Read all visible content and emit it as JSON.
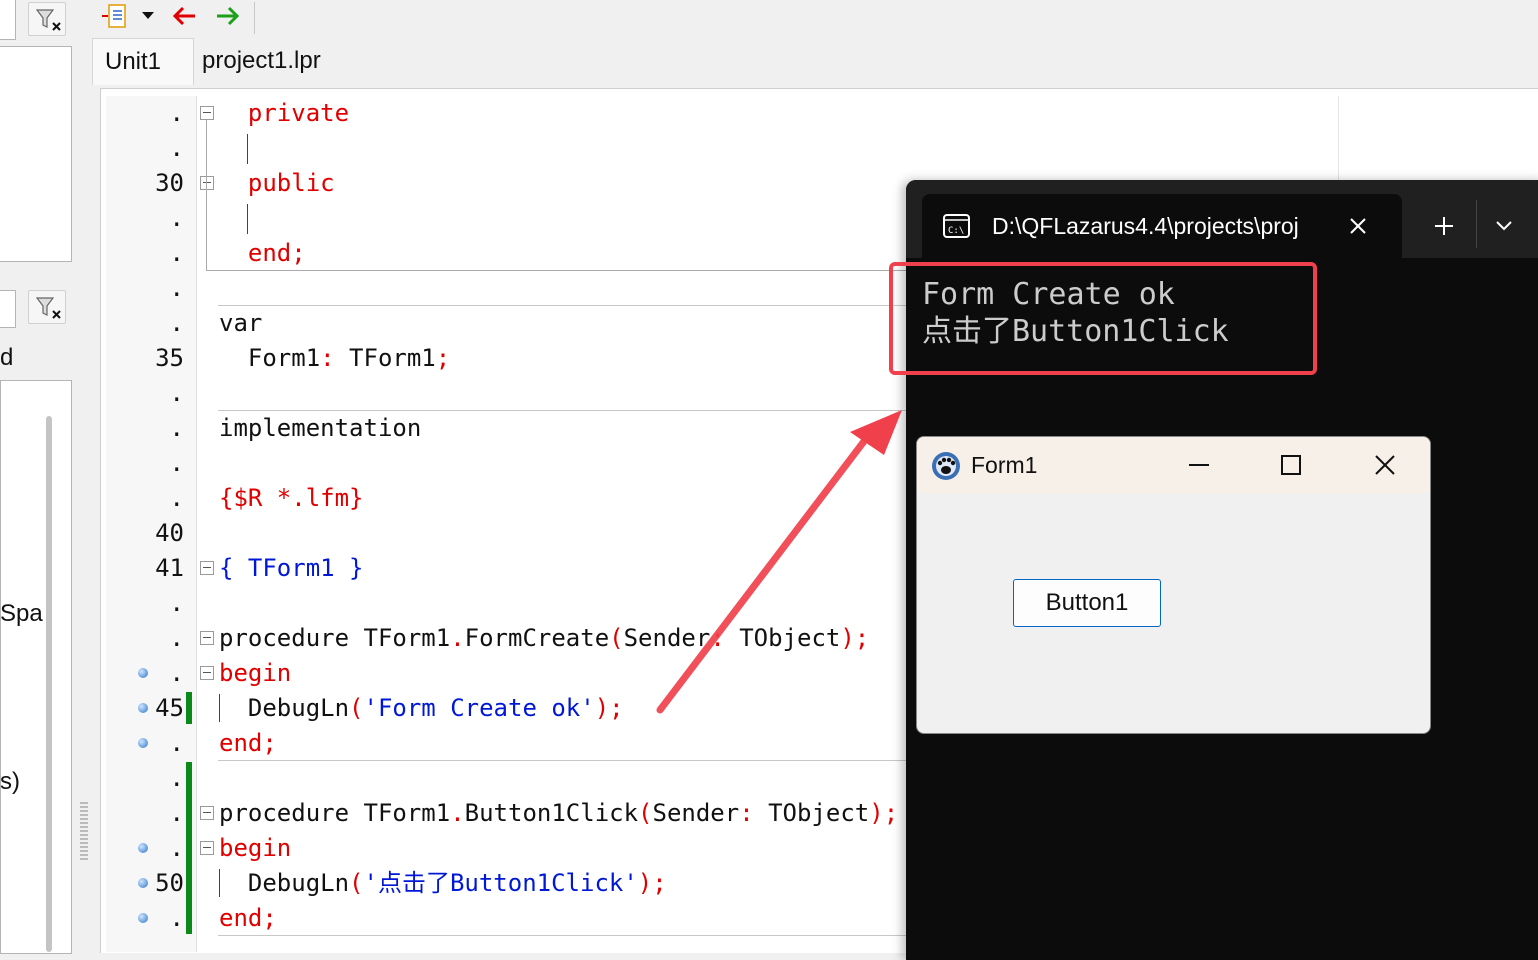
{
  "tabs": [
    {
      "label": "Unit1",
      "active": true
    },
    {
      "label": "project1.lpr",
      "active": false
    }
  ],
  "left_panel": {
    "fragments": [
      "d",
      "Spa",
      "s)"
    ]
  },
  "code": {
    "lines": [
      {
        "num": ".",
        "tokens": [
          {
            "t": "  "
          },
          {
            "t": "private",
            "c": "kw"
          }
        ]
      },
      {
        "num": ".",
        "tokens": []
      },
      {
        "num": "30",
        "tokens": [
          {
            "t": "  "
          },
          {
            "t": "public",
            "c": "kw"
          }
        ]
      },
      {
        "num": ".",
        "tokens": []
      },
      {
        "num": ".",
        "tokens": [
          {
            "t": "  "
          },
          {
            "t": "end",
            "c": "kw"
          },
          {
            "t": ";",
            "c": "sym"
          }
        ]
      },
      {
        "num": ".",
        "tokens": []
      },
      {
        "num": ".",
        "tokens": [
          {
            "t": "var",
            "c": "id"
          }
        ]
      },
      {
        "num": "35",
        "tokens": [
          {
            "t": "  Form1",
            "c": "id"
          },
          {
            "t": ":",
            "c": "sym"
          },
          {
            "t": " TForm1",
            "c": "id"
          },
          {
            "t": ";",
            "c": "sym"
          }
        ]
      },
      {
        "num": ".",
        "tokens": []
      },
      {
        "num": ".",
        "tokens": [
          {
            "t": "implementation",
            "c": "id"
          }
        ]
      },
      {
        "num": ".",
        "tokens": []
      },
      {
        "num": ".",
        "tokens": [
          {
            "t": "{$R *.lfm}",
            "c": "kw"
          }
        ]
      },
      {
        "num": "40",
        "tokens": []
      },
      {
        "num": "41",
        "tokens": [
          {
            "t": "{ TForm1 }",
            "c": "bl"
          }
        ]
      },
      {
        "num": ".",
        "tokens": []
      },
      {
        "num": ".",
        "tokens": [
          {
            "t": "procedure ",
            "c": "id"
          },
          {
            "t": "TForm1",
            "c": "id"
          },
          {
            "t": ".",
            "c": "sym"
          },
          {
            "t": "FormCreate",
            "c": "id"
          },
          {
            "t": "(",
            "c": "sym"
          },
          {
            "t": "Sender",
            "c": "id"
          },
          {
            "t": ":",
            "c": "sym"
          },
          {
            "t": " TObject",
            "c": "id"
          },
          {
            "t": ");",
            "c": "sym"
          }
        ]
      },
      {
        "num": ".",
        "tokens": [
          {
            "t": "begin",
            "c": "kw"
          }
        ]
      },
      {
        "num": "45",
        "tokens": [
          {
            "t": "  DebugLn",
            "c": "id"
          },
          {
            "t": "(",
            "c": "sym"
          },
          {
            "t": "'Form Create ok'",
            "c": "bl"
          },
          {
            "t": ");",
            "c": "sym"
          }
        ]
      },
      {
        "num": ".",
        "tokens": [
          {
            "t": "end",
            "c": "kw"
          },
          {
            "t": ";",
            "c": "sym"
          }
        ]
      },
      {
        "num": ".",
        "tokens": []
      },
      {
        "num": ".",
        "tokens": [
          {
            "t": "procedure ",
            "c": "id"
          },
          {
            "t": "TForm1",
            "c": "id"
          },
          {
            "t": ".",
            "c": "sym"
          },
          {
            "t": "Button1Click",
            "c": "id"
          },
          {
            "t": "(",
            "c": "sym"
          },
          {
            "t": "Sender",
            "c": "id"
          },
          {
            "t": ":",
            "c": "sym"
          },
          {
            "t": " TObject",
            "c": "id"
          },
          {
            "t": ");",
            "c": "sym"
          }
        ]
      },
      {
        "num": ".",
        "tokens": [
          {
            "t": "begin",
            "c": "kw"
          }
        ]
      },
      {
        "num": "50",
        "tokens": [
          {
            "t": "  DebugLn",
            "c": "id"
          },
          {
            "t": "(",
            "c": "sym"
          },
          {
            "t": "'点击了Button1Click'",
            "c": "bl"
          },
          {
            "t": ");",
            "c": "sym"
          }
        ]
      },
      {
        "num": ".",
        "tokens": [
          {
            "t": "end",
            "c": "kw"
          },
          {
            "t": ";",
            "c": "sym"
          }
        ]
      }
    ]
  },
  "terminal": {
    "tab_title": "D:\\QFLazarus4.4\\projects\\proj",
    "output": [
      "Form Create ok",
      "点击了Button1Click"
    ]
  },
  "form1": {
    "title": "Form1",
    "button_label": "Button1"
  },
  "colors": {
    "keyword": "#e00000",
    "string": "#0018d6",
    "highlight_box": "#f0404c",
    "terminal_bg": "#0c0c0c"
  }
}
